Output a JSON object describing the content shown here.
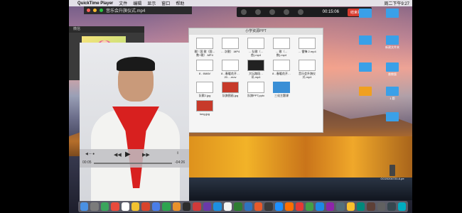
{
  "menubar": {
    "app": "QuickTime Player",
    "items": [
      "文件",
      "编辑",
      "显示",
      "窗口",
      "帮助"
    ],
    "clock": "周二下午9:27"
  },
  "qt_window": {
    "title": "音乐会升旗仪式.mp4"
  },
  "zoom": {
    "timer": "00:15:06",
    "end_label": "结束共享",
    "share_label": "暂停共享"
  },
  "small_preview": {
    "title": "微信"
  },
  "finder": {
    "title": "小学资源PPT",
    "files": [
      {
        "name": "歌）国 歌（国… 数+歌）.MP4",
        "thumb": "doc"
      },
      {
        "name": "… 次歌）.MP4",
        "thumb": "doc"
      },
      {
        "name": "… 队歌（… 首).mp4",
        "thumb": "doc"
      },
      {
        "name": "… 歌（… 数).mp4",
        "thumb": "doc"
      },
      {
        "name": "… 雷锋 2.mp4",
        "thumb": "doc"
      },
      {
        "name": "8 - 6MAV",
        "thumb": "doc"
      },
      {
        "name": "8 - 春暖花开…20….mov",
        "thumb": "doc"
      },
      {
        "name": "大坛路段… 讯.mp4",
        "thumb": "dark"
      },
      {
        "name": "8 - 春暖花开…",
        "thumb": "doc"
      },
      {
        "name": "音乐会升旗仪式.mp4",
        "thumb": "doc"
      },
      {
        "name": "队歌2.jpg",
        "thumb": "doc"
      },
      {
        "name": "队旗图画.jpg",
        "thumb": "red"
      },
      {
        "name": "队旗PPT.pptx",
        "thumb": "doc"
      },
      {
        "name": "三化主题课",
        "thumb": "blue"
      },
      {
        "name": "",
        "thumb": "none"
      },
      {
        "name": "long.jpg",
        "thumb": "red"
      }
    ]
  },
  "player": {
    "elapsed": "00:05",
    "remaining": "-04:26"
  },
  "desktop_icons": [
    {
      "label": "",
      "style": "blue"
    },
    {
      "label": "",
      "style": "blue"
    },
    {
      "label": "",
      "style": "blue"
    },
    {
      "label": "新建文件夹",
      "style": "blue"
    },
    {
      "label": "",
      "style": "blue"
    },
    {
      "label": "普教版",
      "style": "blue"
    },
    {
      "label": "",
      "style": "orange"
    },
    {
      "label": "1 题",
      "style": "blue"
    },
    {
      "label": "",
      "style": "blue"
    },
    {
      "label": "GO20200720-6.pe",
      "style": "gray"
    }
  ]
}
